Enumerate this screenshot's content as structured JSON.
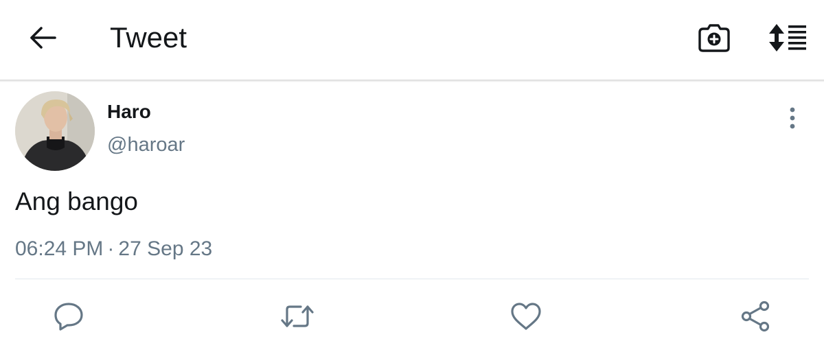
{
  "header": {
    "title": "Tweet",
    "icons": {
      "back": "arrow-left-icon",
      "camera": "camera-plus-icon",
      "sort": "sort-lines-icon"
    }
  },
  "tweet": {
    "author": {
      "display_name": "Haro",
      "handle": "@haroar"
    },
    "text": "Ang bango",
    "time": "06:24 PM",
    "separator": "·",
    "date": "27 Sep 23"
  },
  "actions": {
    "icons": [
      "reply-icon",
      "retweet-icon",
      "like-icon",
      "share-icon"
    ]
  },
  "colors": {
    "text_primary": "#14171a",
    "text_secondary": "#657786",
    "action_icon": "#657786",
    "divider": "#e1e8ed"
  }
}
